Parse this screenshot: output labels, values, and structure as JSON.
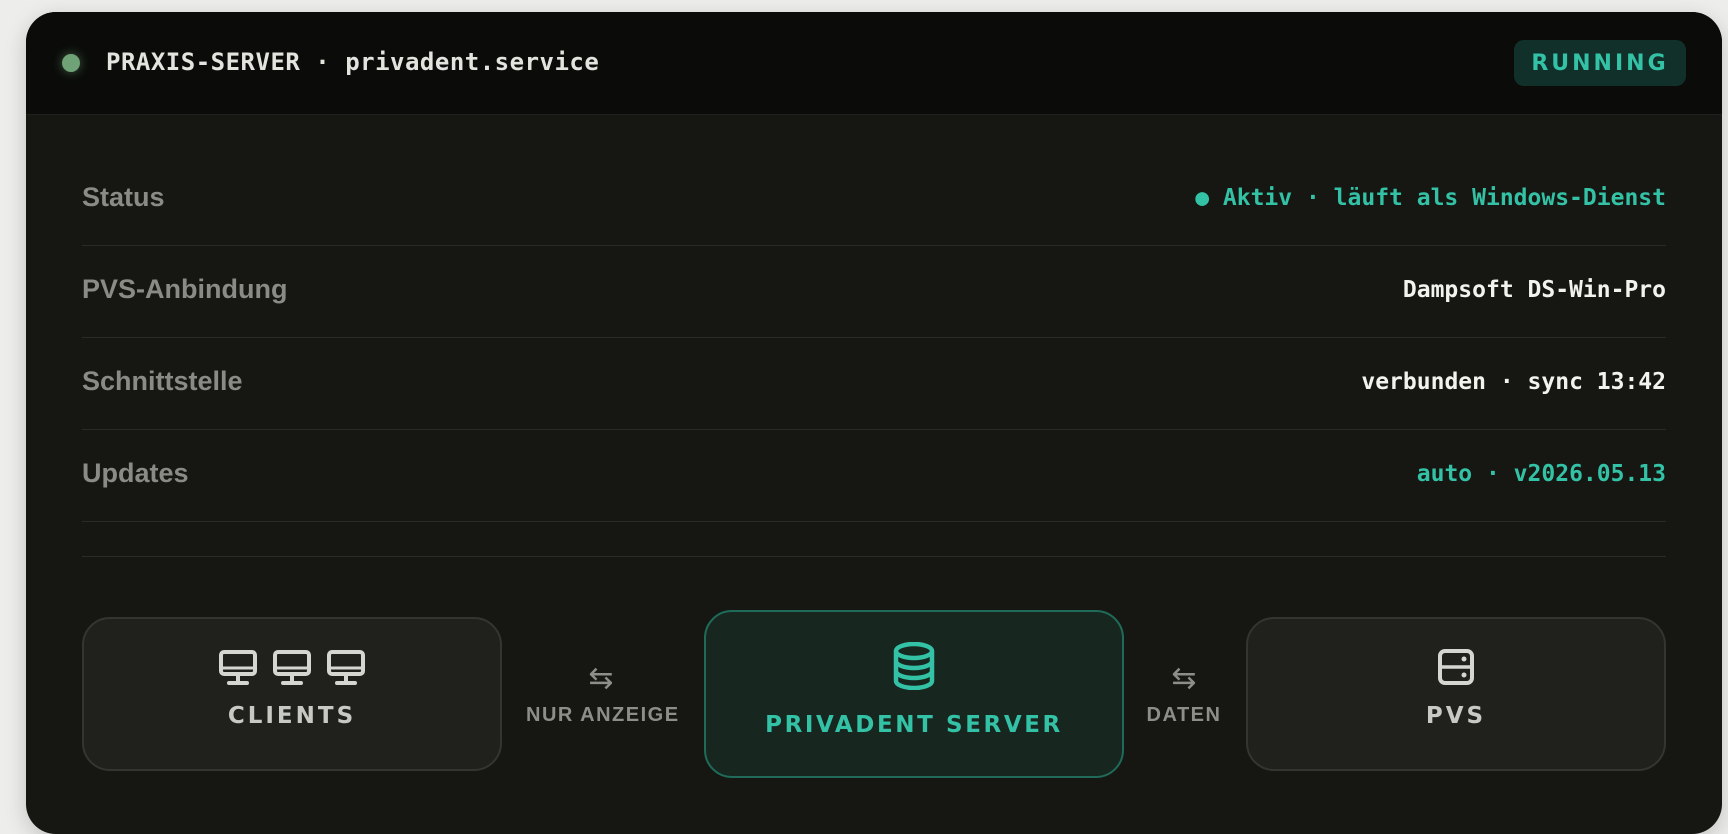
{
  "header": {
    "title": "PRAXIS-SERVER · privadent.service",
    "status_badge": "RUNNING",
    "indicator_color": "#6fa276"
  },
  "details": [
    {
      "label": "Status",
      "value": "● Aktiv · läuft als Windows-Dienst",
      "tone": "teal"
    },
    {
      "label": "PVS-Anbindung",
      "value": "Dampsoft DS-Win-Pro",
      "tone": "white"
    },
    {
      "label": "Schnittstelle",
      "value": "verbunden · sync 13:42",
      "tone": "white"
    },
    {
      "label": "Updates",
      "value": "auto · v2026.05.13",
      "tone": "teal"
    }
  ],
  "diagram": {
    "clients": {
      "label": "CLIENTS",
      "icon": "monitor-icon"
    },
    "link_left": {
      "label": "NUR ANZEIGE",
      "icon": "swap-arrows-icon"
    },
    "server": {
      "label": "PRIVADENT SERVER",
      "icon": "database-icon"
    },
    "link_right": {
      "label": "DATEN",
      "icon": "swap-arrows-icon"
    },
    "pvs": {
      "label": "PVS",
      "icon": "server-icon"
    }
  },
  "colors": {
    "accent": "#33c2a6",
    "panel_bg": "#161713",
    "header_bg": "#0b0c0a"
  }
}
